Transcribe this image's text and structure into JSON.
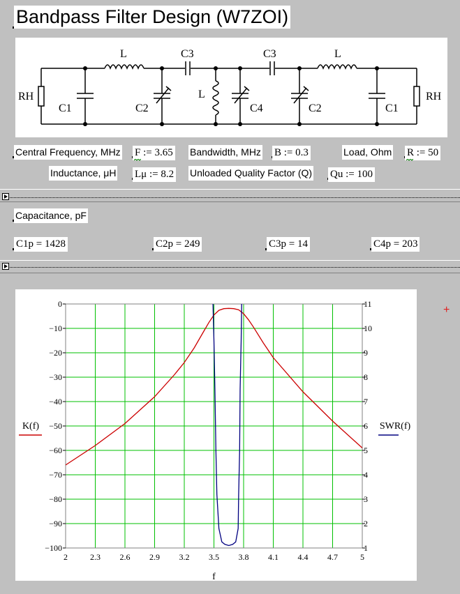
{
  "title": "Bandpass Filter Design (W7ZOI)",
  "schematic": {
    "labels": {
      "rh_left": "RH",
      "rh_right": "RH",
      "c1_left": "C1",
      "c1_right": "C1",
      "c2_left": "C2",
      "c2_right": "C2",
      "c3_left": "C3",
      "c3_right": "C3",
      "c4": "C4",
      "l_left": "L",
      "l_mid": "L",
      "l_right": "L"
    }
  },
  "inputs": {
    "freq_label": "Central Frequency, MHz",
    "freq_expr": "F := 3.65",
    "bw_label": "Bandwidth, MHz",
    "bw_expr": "B := 0.3",
    "load_label": "Load, Ohm",
    "load_expr": "R := 50",
    "ind_label": "Inductance, μH",
    "ind_expr": "Lμ := 8.2",
    "q_label": "Unloaded Quality Factor (Q)",
    "q_expr": "Qu := 100"
  },
  "results": {
    "heading": "Capacitance, pF",
    "c1p": "C1p = 1428",
    "c2p": "C2p = 249",
    "c3p": "C3p = 14",
    "c4p": "C4p = 203"
  },
  "plot_marker": "+",
  "chart_data": {
    "type": "line",
    "xlabel": "f",
    "xlim": [
      2,
      5
    ],
    "x_ticks": [
      "2",
      "2.3",
      "2.6",
      "2.9",
      "3.2",
      "3.5",
      "3.8",
      "4.1",
      "4.4",
      "4.7",
      "5"
    ],
    "left_axis": {
      "label": "K(f)",
      "ylim": [
        -100,
        0
      ],
      "ticks": [
        "0",
        "-10",
        "-20",
        "-30",
        "-40",
        "-50",
        "-60",
        "-70",
        "-80",
        "-90",
        "-100"
      ]
    },
    "right_axis": {
      "label": "SWR(f)",
      "ylim": [
        1,
        11
      ],
      "ticks": [
        "11",
        "10",
        "9",
        "8",
        "7",
        "6",
        "5",
        "4",
        "3",
        "2",
        "1"
      ]
    },
    "grid": true,
    "colors": {
      "K": "#cc0000",
      "SWR": "#000080",
      "grid": "#00c000"
    },
    "series": [
      {
        "name": "K(f)",
        "axis": "left",
        "x": [
          2.0,
          2.3,
          2.6,
          2.9,
          3.1,
          3.2,
          3.3,
          3.4,
          3.45,
          3.5,
          3.55,
          3.6,
          3.65,
          3.7,
          3.75,
          3.8,
          3.85,
          3.9,
          4.0,
          4.1,
          4.4,
          4.7,
          5.0
        ],
        "y": [
          -66,
          -58,
          -49,
          -38,
          -29,
          -24,
          -18,
          -11,
          -7.5,
          -4.5,
          -2.6,
          -1.9,
          -1.8,
          -1.9,
          -2.4,
          -4,
          -6.5,
          -9.5,
          -16,
          -22,
          -36,
          -48,
          -59
        ]
      },
      {
        "name": "SWR(f)",
        "axis": "right",
        "x": [
          3.49,
          3.5,
          3.51,
          3.52,
          3.53,
          3.55,
          3.58,
          3.61,
          3.65,
          3.69,
          3.72,
          3.745,
          3.75,
          3.76,
          3.765,
          3.775,
          3.78
        ],
        "y": [
          11,
          9.5,
          7.5,
          5,
          3.2,
          1.8,
          1.25,
          1.15,
          1.1,
          1.15,
          1.25,
          1.8,
          3.2,
          5,
          7.5,
          9.5,
          11
        ]
      }
    ]
  }
}
